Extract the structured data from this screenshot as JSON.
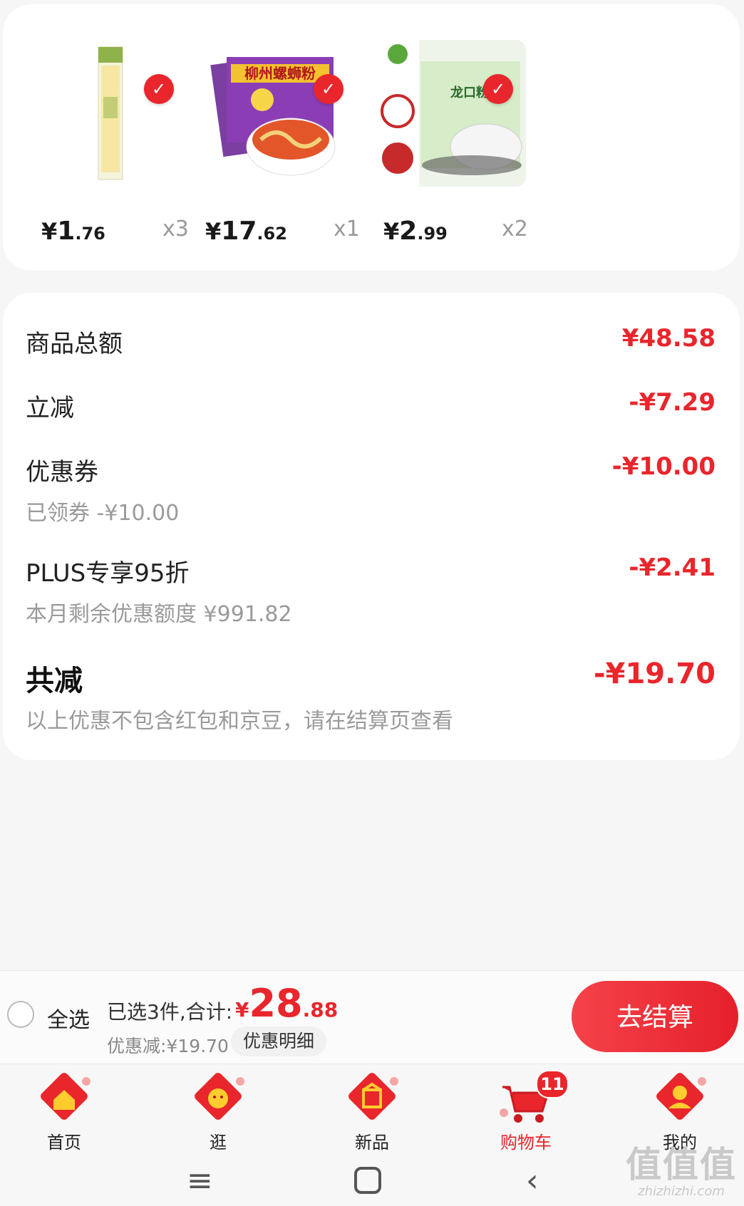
{
  "products": [
    {
      "price_currency": "¥",
      "price_int": "1",
      "price_dec": ".76",
      "qty": "x3",
      "icon": "spaghetti-pack"
    },
    {
      "price_currency": "¥",
      "price_int": "17",
      "price_dec": ".62",
      "qty": "x1",
      "icon": "luosifen-pack",
      "pack_text": "柳州螺蛳粉"
    },
    {
      "price_currency": "¥",
      "price_int": "2",
      "price_dec": ".99",
      "qty": "x2",
      "icon": "vermicelli-pack",
      "pack_text": "龙口粉丝"
    }
  ],
  "summary": {
    "total_label": "商品总额",
    "total_value": "¥48.58",
    "instant_label": "立减",
    "instant_value": "-¥7.29",
    "coupon_label": "优惠券",
    "coupon_value": "-¥10.00",
    "coupon_sub": "已领券 -¥10.00",
    "plus_label": "PLUS专享95折",
    "plus_value": "-¥2.41",
    "plus_sub": "本月剩余优惠额度 ¥991.82",
    "sum_label": "共减",
    "sum_value": "-¥19.70",
    "sum_sub": "以上优惠不包含红包和京豆，请在结算页查看"
  },
  "checkout": {
    "select_all": "全选",
    "selected_text": "已选3件,合计:",
    "total_currency": "¥",
    "total_int": "28",
    "total_dec": ".88",
    "discount_text": "优惠减:¥19.70",
    "detail_button": "优惠明细",
    "checkout_button": "去结算"
  },
  "tabs": [
    {
      "label": "首页",
      "icon": "home-icon"
    },
    {
      "label": "逛",
      "icon": "browse-icon"
    },
    {
      "label": "新品",
      "icon": "new-items-icon"
    },
    {
      "label": "购物车",
      "icon": "cart-icon",
      "badge": "11",
      "active": true
    },
    {
      "label": "我的",
      "icon": "profile-icon"
    }
  ],
  "watermark": {
    "big": "值值值",
    "small": "zhizhizhi.com"
  },
  "colors": {
    "accent": "#e8262c",
    "background": "#f6f6f6"
  }
}
